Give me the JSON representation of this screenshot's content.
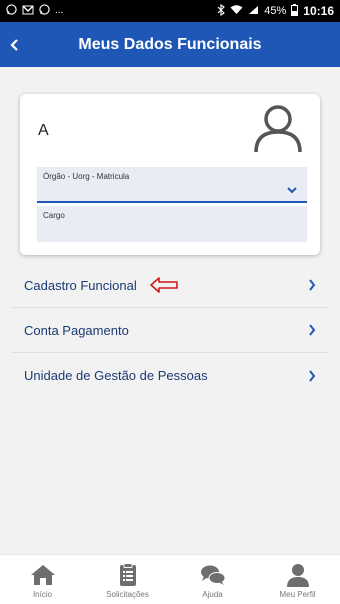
{
  "status_bar": {
    "left_icons": [
      "whatsapp-icon",
      "email-icon",
      "whatsapp-icon",
      "more-icon"
    ],
    "more": "...",
    "battery": "45%",
    "time": "10:16"
  },
  "app_bar": {
    "title": "Meus Dados Funcionais"
  },
  "profile_card": {
    "name": "A",
    "orgao_label": "Órgão - Uorg - Matricula",
    "cargo_label": "Cargo"
  },
  "menu": {
    "items": [
      {
        "label": "Cadastro Funcional"
      },
      {
        "label": "Conta Pagamento"
      },
      {
        "label": "Unidade de Gestão de Pessoas"
      }
    ]
  },
  "bottom_nav": {
    "items": [
      {
        "label": "Início",
        "icon": "home-icon"
      },
      {
        "label": "Solicitações",
        "icon": "clipboard-icon"
      },
      {
        "label": "Ajuda",
        "icon": "chat-bubbles-icon"
      },
      {
        "label": "Meu Perfil",
        "icon": "person-icon"
      }
    ]
  },
  "colors": {
    "primary": "#1f57b6",
    "menu_text": "#1b3a73",
    "annotation": "#d01818",
    "nav_icon": "#6e6e6e"
  }
}
